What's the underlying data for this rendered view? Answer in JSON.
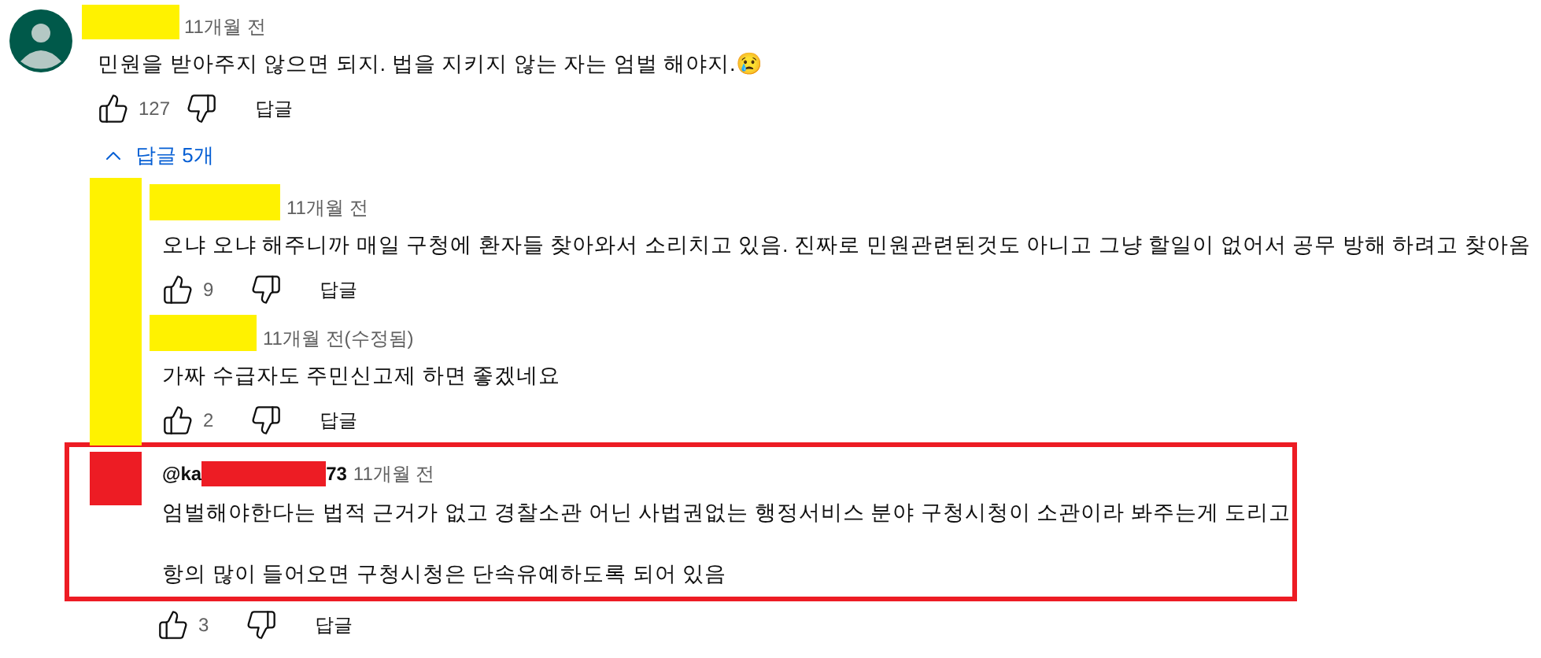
{
  "comment": {
    "name_mask": {
      "color": "#fff200"
    },
    "time": "11개월 전",
    "text": "민원을 받아주지 않으면 되지. 법을 지키지 않는 자는 엄벌 해야지.😢",
    "likes": "127",
    "reply_button": "답글"
  },
  "replies_toggle": {
    "label": "답글 5개",
    "expanded": true
  },
  "reply_group": {
    "avatar_mask": {
      "color": "#fff200"
    },
    "replies": [
      {
        "name_mask": {
          "color": "#fff200"
        },
        "time": "11개월 전",
        "paragraphs": [
          "오냐 오냐 해주니까 매일 구청에 환자들 찾아와서 소리치고 있음. 진짜로 민원관련된것도 아니고 그냥 할일이 없어서 공무 방해 하려고 찾아옴"
        ],
        "likes": "9",
        "reply_button": "답글"
      },
      {
        "name_mask": {
          "color": "#fff200"
        },
        "time": "11개월 전(수정됨)",
        "paragraphs": [
          "가짜 수급자도 주민신고제 하면 좋겠네요"
        ],
        "likes": "2",
        "reply_button": "답글"
      }
    ]
  },
  "highlighted_reply": {
    "frame": {
      "color": "#ed1c24"
    },
    "avatar_mask": {
      "color": "#ed1c24"
    },
    "handle_start": "@ka",
    "handle_mask": {
      "color": "#ed1c24"
    },
    "handle_end": "73",
    "time": "11개월 전",
    "paragraphs": [
      "엄벌해야한다는 법적 근거가 없고 경찰소관 어닌 사법권없는 행정서비스 분야 구청시청이 소관이라 봐주는게 도리고",
      "항의 많이 들어오면 구청시청은 단속유예하도록 되어 있음"
    ],
    "likes": "3",
    "reply_button": "답글"
  }
}
